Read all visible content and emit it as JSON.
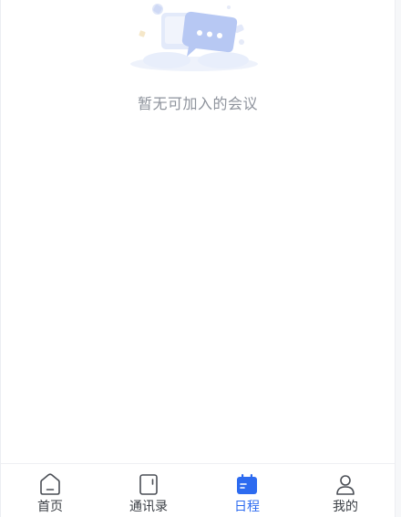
{
  "empty": {
    "message": "暂无可加入的会议",
    "illustration": "chat-bubble-illustration"
  },
  "tabbar": {
    "active_color": "#2d6bf0",
    "inactive_color": "#3b3f45",
    "tabs": [
      {
        "label": "首页",
        "icon": "home-icon",
        "active": false
      },
      {
        "label": "通讯录",
        "icon": "contacts-icon",
        "active": false
      },
      {
        "label": "日程",
        "icon": "calendar-icon",
        "active": true
      },
      {
        "label": "我的",
        "icon": "profile-icon",
        "active": false
      }
    ]
  }
}
